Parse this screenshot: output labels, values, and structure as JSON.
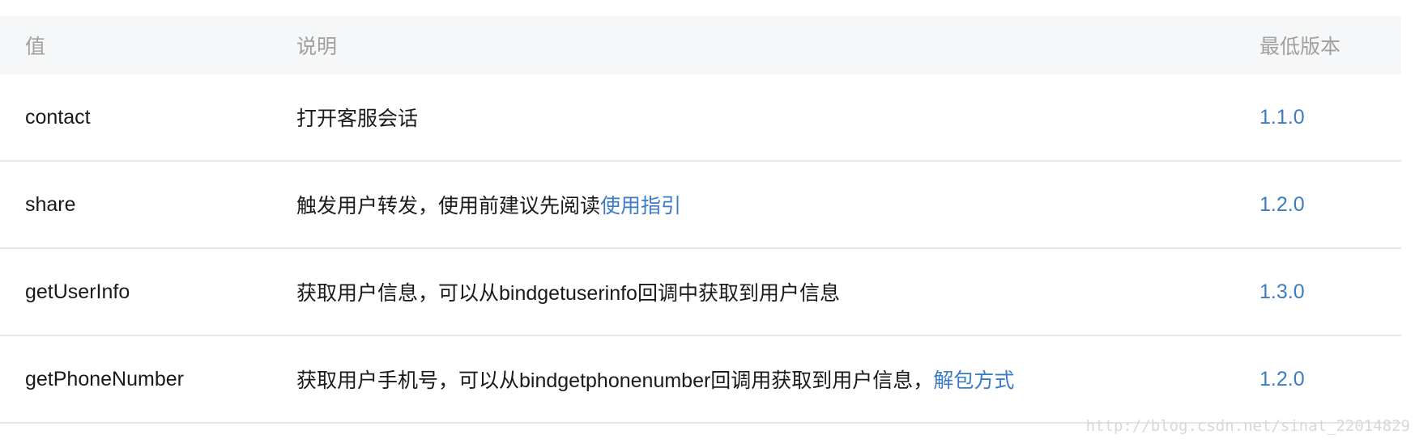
{
  "table": {
    "headers": {
      "value": "值",
      "description": "说明",
      "min_version": "最低版本"
    },
    "rows": [
      {
        "value": "contact",
        "description": "打开客服会话",
        "link": "",
        "version": "1.1.0"
      },
      {
        "value": "share",
        "description": "触发用户转发，使用前建议先阅读",
        "link": "使用指引",
        "version": "1.2.0"
      },
      {
        "value": "getUserInfo",
        "description": "获取用户信息，可以从bindgetuserinfo回调中获取到用户信息",
        "link": "",
        "version": "1.3.0"
      },
      {
        "value": "getPhoneNumber",
        "description": "获取用户手机号，可以从bindgetphonenumber回调用获取到用户信息，",
        "link": "解包方式",
        "version": "1.2.0"
      }
    ]
  },
  "watermark": "http://blog.csdn.net/sinat_22014829",
  "colors": {
    "header_bg": "#f6f7f8",
    "link": "#3b7cc4",
    "divider": "#e6e6e6"
  }
}
